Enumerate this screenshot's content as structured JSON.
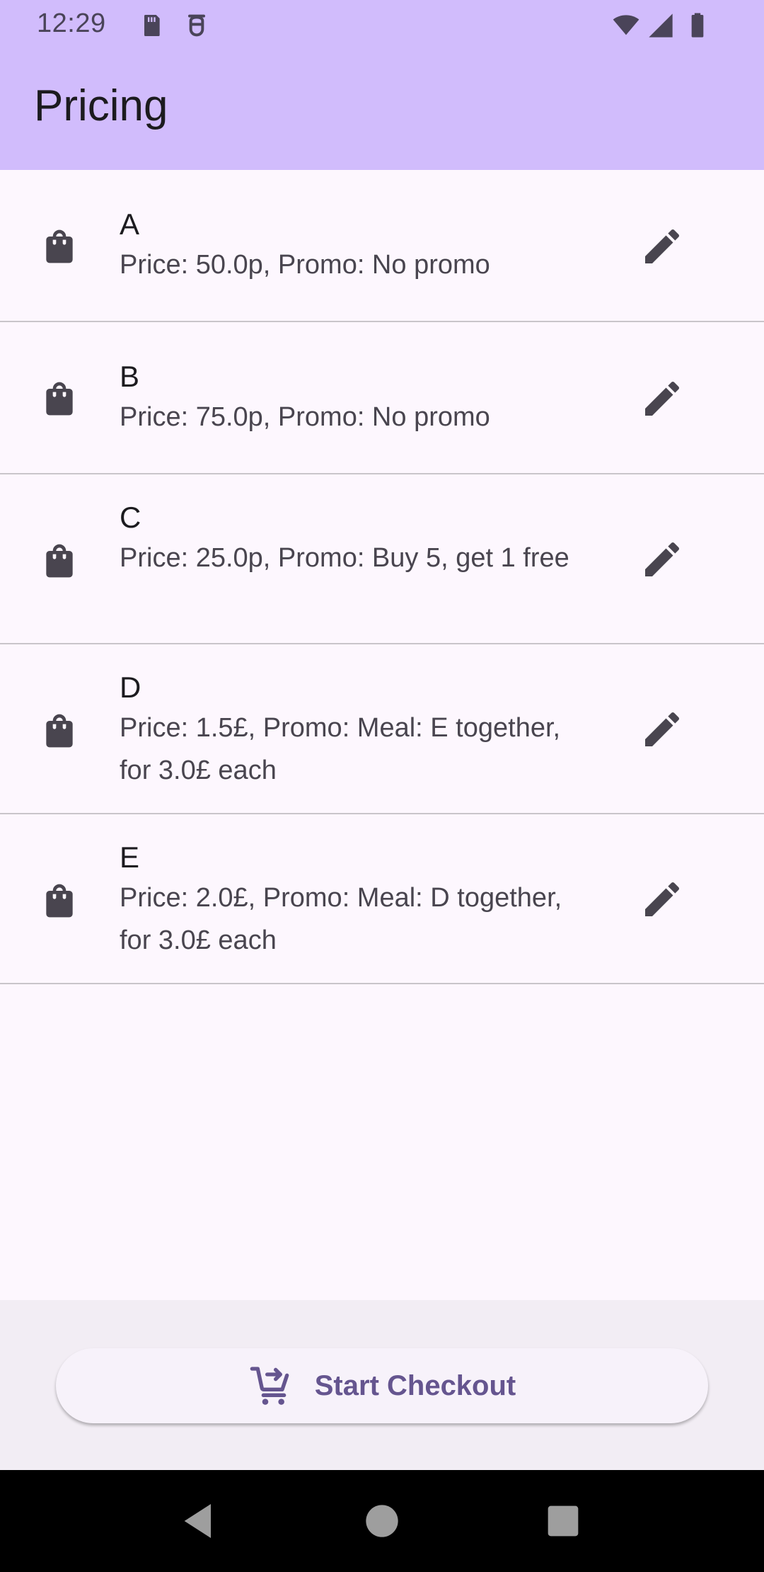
{
  "status_bar": {
    "time": "12:29",
    "icons": [
      "sd-card-icon",
      "debug-icon",
      "wifi-icon",
      "signal-icon",
      "battery-icon"
    ]
  },
  "app_bar": {
    "title": "Pricing"
  },
  "items": [
    {
      "name": "A",
      "details": "Price: 50.0p, Promo: No promo"
    },
    {
      "name": "B",
      "details": "Price: 75.0p, Promo: No promo"
    },
    {
      "name": "C",
      "details": "Price: 25.0p, Promo: Buy 5, get 1 free"
    },
    {
      "name": "D",
      "details": "Price: 1.5£, Promo: Meal: E together, for 3.0£ each"
    },
    {
      "name": "E",
      "details": "Price: 2.0£, Promo: Meal: D together, for 3.0£ each"
    }
  ],
  "checkout": {
    "label": "Start Checkout",
    "icon": "cart-arrow-icon"
  },
  "nav": [
    "back-icon",
    "home-icon",
    "recents-icon"
  ],
  "colors": {
    "app_bar": "#D1BCFC",
    "background": "#FDF7FE",
    "accent": "#65558F"
  }
}
